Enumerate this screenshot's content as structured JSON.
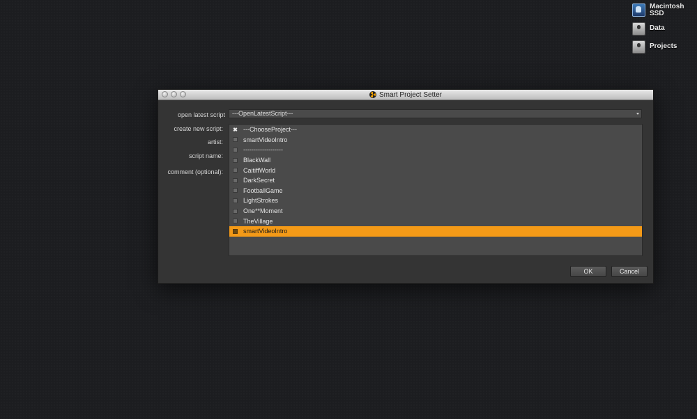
{
  "desktop": {
    "icons": [
      {
        "label_line1": "Macintosh",
        "label_line2": "SSD",
        "icon": "hard-drive-icon"
      },
      {
        "label": "Data",
        "icon": "hard-drive-icon"
      },
      {
        "label": "Projects",
        "icon": "hard-drive-icon"
      }
    ]
  },
  "window": {
    "title": "Smart Project Setter",
    "app_icon": "nuke-icon"
  },
  "form": {
    "open_latest_label": "open latest script",
    "open_latest_value": "---OpenLatestScript---",
    "create_new_label": "create new script:",
    "artist_label": "artist:",
    "script_name_label": "script name:",
    "comment_label": "comment (optional):"
  },
  "project_list": {
    "items": [
      {
        "label": "---ChooseProject---",
        "mark": "✖"
      },
      {
        "label": "smartVideoIntro"
      },
      {
        "label": "-------------------"
      },
      {
        "label": "BlackWall"
      },
      {
        "label": "CaitiffWorld"
      },
      {
        "label": "DarkSecret"
      },
      {
        "label": "FootballGame"
      },
      {
        "label": "LightStrokes"
      },
      {
        "label": "One**Moment"
      },
      {
        "label": "TheVillage"
      },
      {
        "label": "smartVideoIntro",
        "selected": true
      }
    ]
  },
  "buttons": {
    "ok": "OK",
    "cancel": "Cancel"
  },
  "colors": {
    "highlight": "#f49a17",
    "window_bg": "#343434",
    "desktop_bg": "#1c1d20"
  }
}
